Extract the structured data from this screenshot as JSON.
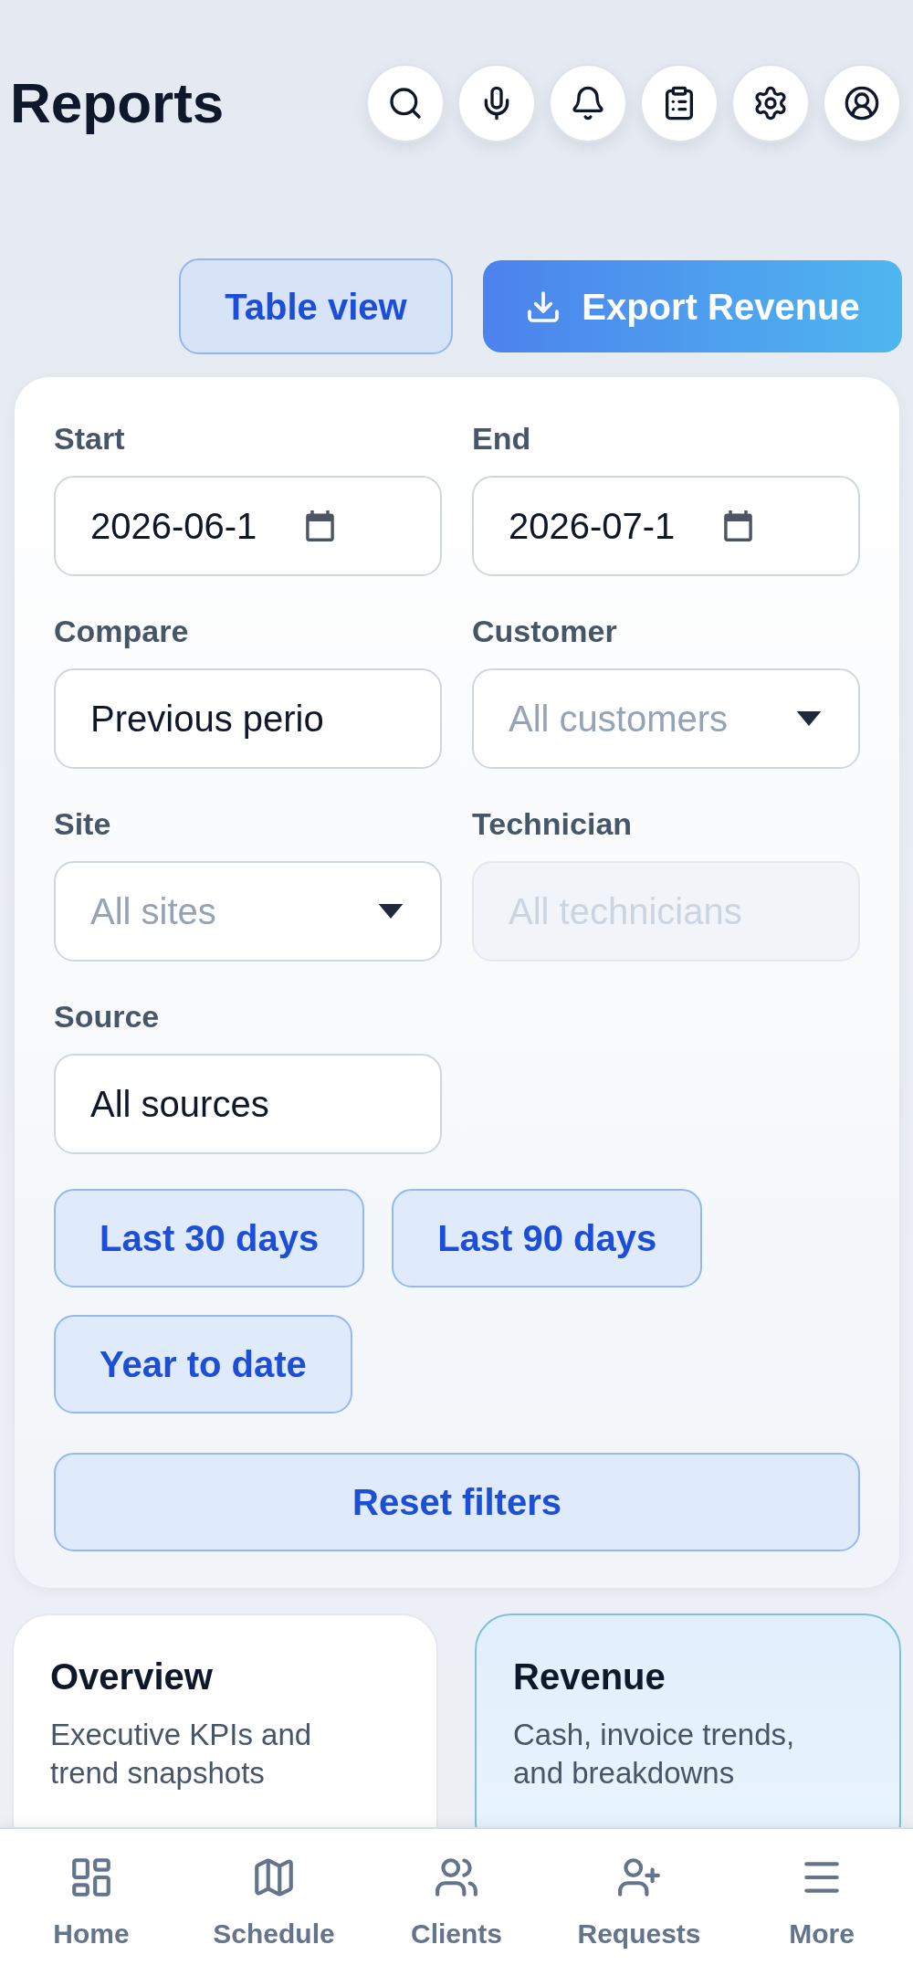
{
  "header": {
    "title": "Reports"
  },
  "toolbar": {
    "buttons": [
      {
        "label": "Table view",
        "kind": "secondary"
      },
      {
        "label": "Export Revenue",
        "kind": "primary"
      }
    ]
  },
  "filters": {
    "fields": [
      {
        "label": "Start",
        "kind": "date",
        "value": "2026-06-1",
        "disabled": false
      },
      {
        "label": "End",
        "kind": "date",
        "value": "2026-07-1",
        "disabled": false
      },
      {
        "label": "Compare",
        "kind": "text",
        "value": "Previous perio",
        "disabled": false
      },
      {
        "label": "Customer",
        "kind": "select",
        "placeholder": "All customers",
        "disabled": false
      },
      {
        "label": "Site",
        "kind": "select",
        "placeholder": "All sites",
        "disabled": false
      },
      {
        "label": "Technician",
        "kind": "text",
        "placeholder": "All technicians",
        "disabled": true
      },
      {
        "label": "Source",
        "kind": "text",
        "value": "All sources",
        "disabled": false
      }
    ],
    "presets": [
      "Last 30 days",
      "Last 90 days",
      "Year to date"
    ],
    "reset_button": "Reset filters"
  },
  "report_types": [
    {
      "title": "Overview",
      "description": "Executive KPIs and trend snapshots",
      "selected": false
    },
    {
      "title": "Revenue",
      "description": "Cash, invoice trends, and breakdowns",
      "selected": true
    }
  ],
  "bottom_nav": {
    "items": [
      {
        "label": "Home"
      },
      {
        "label": "Schedule"
      },
      {
        "label": "Clients"
      },
      {
        "label": "Requests"
      },
      {
        "label": "More"
      }
    ]
  }
}
